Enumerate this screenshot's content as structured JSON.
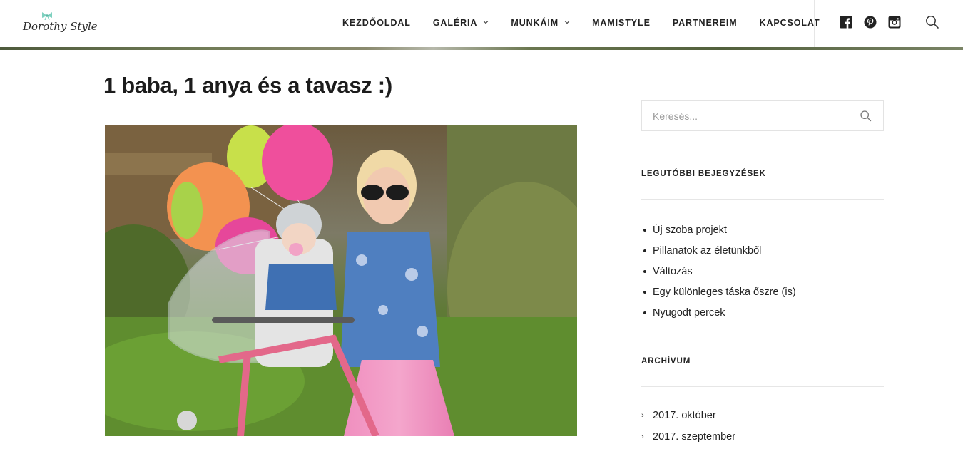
{
  "brand": {
    "logo_text": "Dorothy Style",
    "bow_color": "#7fd1c0"
  },
  "nav": {
    "items": [
      {
        "label": "KEZDŐOLDAL",
        "has_dropdown": false
      },
      {
        "label": "GALÉRIA",
        "has_dropdown": true
      },
      {
        "label": "MUNKÁIM",
        "has_dropdown": true
      },
      {
        "label": "MAMISTYLE",
        "has_dropdown": false
      },
      {
        "label": "PARTNEREIM",
        "has_dropdown": false
      },
      {
        "label": "KAPCSOLAT",
        "has_dropdown": false
      }
    ],
    "dropdown_glyph": "⌄"
  },
  "social": [
    "facebook-icon",
    "pinterest-icon",
    "instagram-icon"
  ],
  "post": {
    "title": "1 baba, 1 anya és a tavasz :)"
  },
  "sidebar": {
    "search": {
      "placeholder": "Keresés..."
    },
    "recent": {
      "title": "LEGUTÓBBI BEJEGYZÉSEK",
      "items": [
        "Új szoba projekt",
        "Pillanatok az életünkből",
        "Változás",
        "Egy különleges táska őszre (is)",
        "Nyugodt percek"
      ]
    },
    "archive": {
      "title": "ARCHÍVUM",
      "items": [
        "2017. október",
        "2017. szeptember"
      ],
      "glyph": "›"
    }
  },
  "colors": {
    "text": "#222222",
    "border": "#e3e3e3",
    "accent_pink": "#ef5aa0"
  }
}
